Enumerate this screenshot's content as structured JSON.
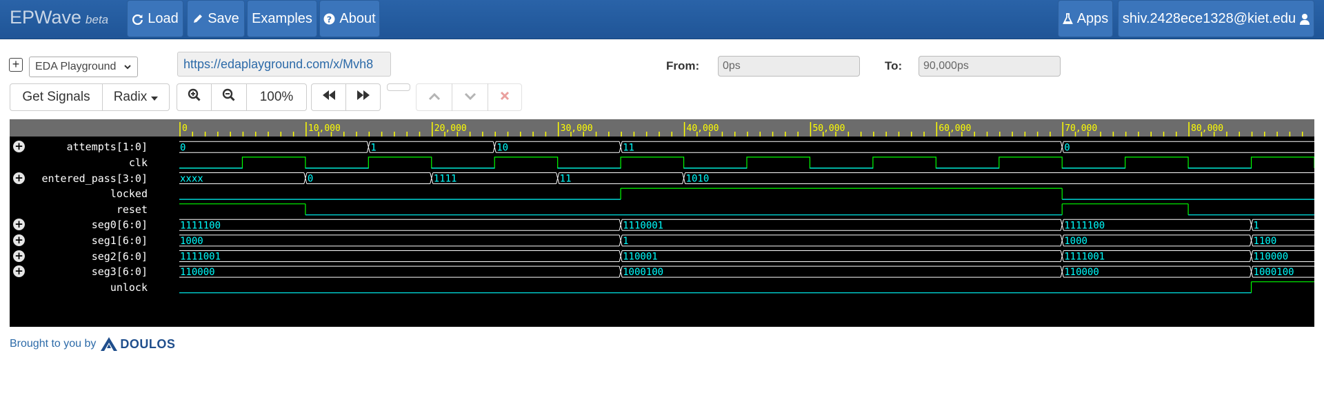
{
  "navbar": {
    "brand": "EPWave",
    "brand_beta": "beta",
    "load": "Load",
    "save": "Save",
    "examples": "Examples",
    "about": "About",
    "apps": "Apps",
    "user": "shiv.2428ece1328@kiet.edu"
  },
  "toolbar": {
    "playground_select": "EDA Playground",
    "url": "https://edaplayground.com/x/Mvh8",
    "from_label": "From:",
    "from_value": "0ps",
    "to_label": "To:",
    "to_value": "90,000ps",
    "get_signals": "Get Signals",
    "radix": "Radix",
    "zoom_level": "100%"
  },
  "waveform": {
    "time_end": 90000,
    "ruler_labels": [
      "0",
      "10,000",
      "20,000",
      "30,000",
      "40,000",
      "50,000",
      "60,000",
      "70,000",
      "80,000"
    ],
    "signals": [
      {
        "name": "attempts[1:0]",
        "type": "bus",
        "expandable": true,
        "changes": [
          [
            0,
            "0"
          ],
          [
            15000,
            "1"
          ],
          [
            25000,
            "10"
          ],
          [
            35000,
            "11"
          ],
          [
            70000,
            "0"
          ]
        ]
      },
      {
        "name": "clk",
        "type": "clock",
        "expandable": false,
        "period": 10000,
        "first_rise": 5000
      },
      {
        "name": "entered_pass[3:0]",
        "type": "bus",
        "expandable": true,
        "changes": [
          [
            0,
            "xxxx"
          ],
          [
            10000,
            "0"
          ],
          [
            20000,
            "1111"
          ],
          [
            30000,
            "11"
          ],
          [
            40000,
            "1010"
          ]
        ]
      },
      {
        "name": "locked",
        "type": "bit",
        "expandable": false,
        "changes": [
          [
            0,
            0
          ],
          [
            35000,
            1
          ],
          [
            70000,
            0
          ]
        ]
      },
      {
        "name": "reset",
        "type": "bit",
        "expandable": false,
        "changes": [
          [
            0,
            1
          ],
          [
            10000,
            0
          ],
          [
            70000,
            1
          ],
          [
            80000,
            0
          ]
        ]
      },
      {
        "name": "seg0[6:0]",
        "type": "bus",
        "expandable": true,
        "changes": [
          [
            0,
            "1111100"
          ],
          [
            35000,
            "1110001"
          ],
          [
            70000,
            "1111100"
          ],
          [
            85000,
            "1"
          ]
        ]
      },
      {
        "name": "seg1[6:0]",
        "type": "bus",
        "expandable": true,
        "changes": [
          [
            0,
            "1000"
          ],
          [
            35000,
            "1"
          ],
          [
            70000,
            "1000"
          ],
          [
            85000,
            "1100"
          ]
        ]
      },
      {
        "name": "seg2[6:0]",
        "type": "bus",
        "expandable": true,
        "changes": [
          [
            0,
            "1111001"
          ],
          [
            35000,
            "110001"
          ],
          [
            70000,
            "1111001"
          ],
          [
            85000,
            "110000"
          ]
        ]
      },
      {
        "name": "seg3[6:0]",
        "type": "bus",
        "expandable": true,
        "changes": [
          [
            0,
            "110000"
          ],
          [
            35000,
            "1000100"
          ],
          [
            70000,
            "110000"
          ],
          [
            85000,
            "1000100"
          ]
        ]
      },
      {
        "name": "unlock",
        "type": "bit",
        "expandable": false,
        "changes": [
          [
            0,
            0
          ],
          [
            85000,
            1
          ]
        ]
      }
    ]
  },
  "footer": {
    "text": "Brought to you by",
    "logo_text": "DOULOS"
  },
  "colors": {
    "navbar": "#1f5597",
    "nav_button": "#3b75bb",
    "wave_bg": "#000000",
    "ruler": "#6c6c6c",
    "ruler_ticks": "#ffff00",
    "bus_value": "#00ffff",
    "bus_line": "#ffffff",
    "bit_high": "#00ff00",
    "bit_low": "#00ffff"
  }
}
